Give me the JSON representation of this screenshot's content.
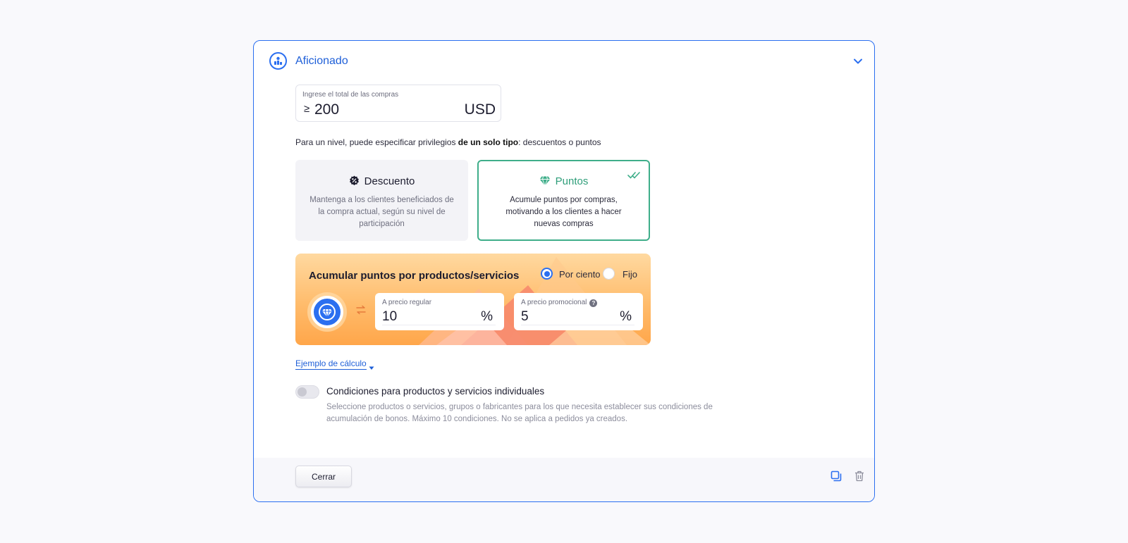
{
  "level": {
    "title": "Aficionado",
    "icon": "level-badge-icon",
    "expand_icon": "chevron-down-icon"
  },
  "purchase_total": {
    "label": "Ingrese el total de las compras",
    "operator": "≥",
    "value": "200",
    "currency": "USD"
  },
  "privileges_note": {
    "before": "Para un nivel, puede especificar privilegios ",
    "bold": "de un solo tipo",
    "after": ": descuentos o puntos"
  },
  "options": {
    "discount": {
      "title": "Descuento",
      "icon": "percent-icon",
      "description": "Mantenga a los clientes beneficiados de la compra actual, según su nivel de participación",
      "selected": false
    },
    "points": {
      "title": "Puntos",
      "icon": "diamond-icon",
      "description": "Acumule puntos por compras, motivando a los clientes a hacer nuevas compras",
      "selected": true
    }
  },
  "accumulate": {
    "title": "Acumular puntos por productos/servicios",
    "mode_percent": "Por ciento",
    "mode_fixed": "Fijo",
    "selected_mode": "Por ciento",
    "regular": {
      "label": "A precio regular",
      "value": "10",
      "unit": "%"
    },
    "promo": {
      "label": "A precio promocional",
      "value": "5",
      "unit": "%"
    }
  },
  "example_link": "Ejemplo de cálculo",
  "conditions": {
    "title": "Condiciones para productos y servicios individuales",
    "description": "Seleccione productos o servicios, grupos o fabricantes para los que necesita establecer sus condiciones de acumulación de bonos. Máximo 10 condiciones. No se aplica a pedidos ya creados.",
    "enabled": false
  },
  "footer": {
    "close_label": "Cerrar",
    "copy_icon": "copy-icon",
    "delete_icon": "trash-icon"
  },
  "colors": {
    "accent": "#2b6ff0",
    "points_green": "#3fae8a",
    "panel_orange": "#ffbc6c"
  }
}
